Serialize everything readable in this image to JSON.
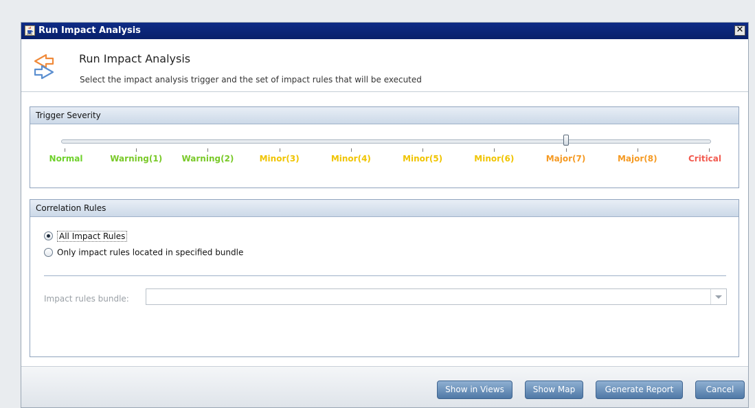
{
  "window": {
    "title": "Run Impact Analysis",
    "close_glyph": "✕"
  },
  "header": {
    "title": "Run Impact Analysis",
    "description": "Select the impact analysis trigger and the set of impact rules that will be executed",
    "icon": "impact-analysis-arrows-icon"
  },
  "trigger": {
    "heading": "Trigger Severity",
    "selected_index": 7,
    "levels": [
      {
        "label": "Normal",
        "color": "#6ed12a"
      },
      {
        "label": "Warning(1)",
        "color": "#79c928"
      },
      {
        "label": "Warning(2)",
        "color": "#79c928"
      },
      {
        "label": "Minor(3)",
        "color": "#f0c400"
      },
      {
        "label": "Minor(4)",
        "color": "#f0c400"
      },
      {
        "label": "Minor(5)",
        "color": "#f0c400"
      },
      {
        "label": "Minor(6)",
        "color": "#f0c400"
      },
      {
        "label": "Major(7)",
        "color": "#f59a23"
      },
      {
        "label": "Major(8)",
        "color": "#f59a23"
      },
      {
        "label": "Critical",
        "color": "#f25a4f"
      }
    ]
  },
  "correlation": {
    "heading": "Correlation Rules",
    "option_all": "All Impact Rules",
    "option_bundle": "Only impact rules located in specified bundle",
    "selected": "all",
    "bundle_label": "Impact rules bundle:",
    "bundle_value": ""
  },
  "footer": {
    "show_in_views": "Show in Views",
    "show_map": "Show Map",
    "generate_report": "Generate Report",
    "cancel": "Cancel"
  }
}
